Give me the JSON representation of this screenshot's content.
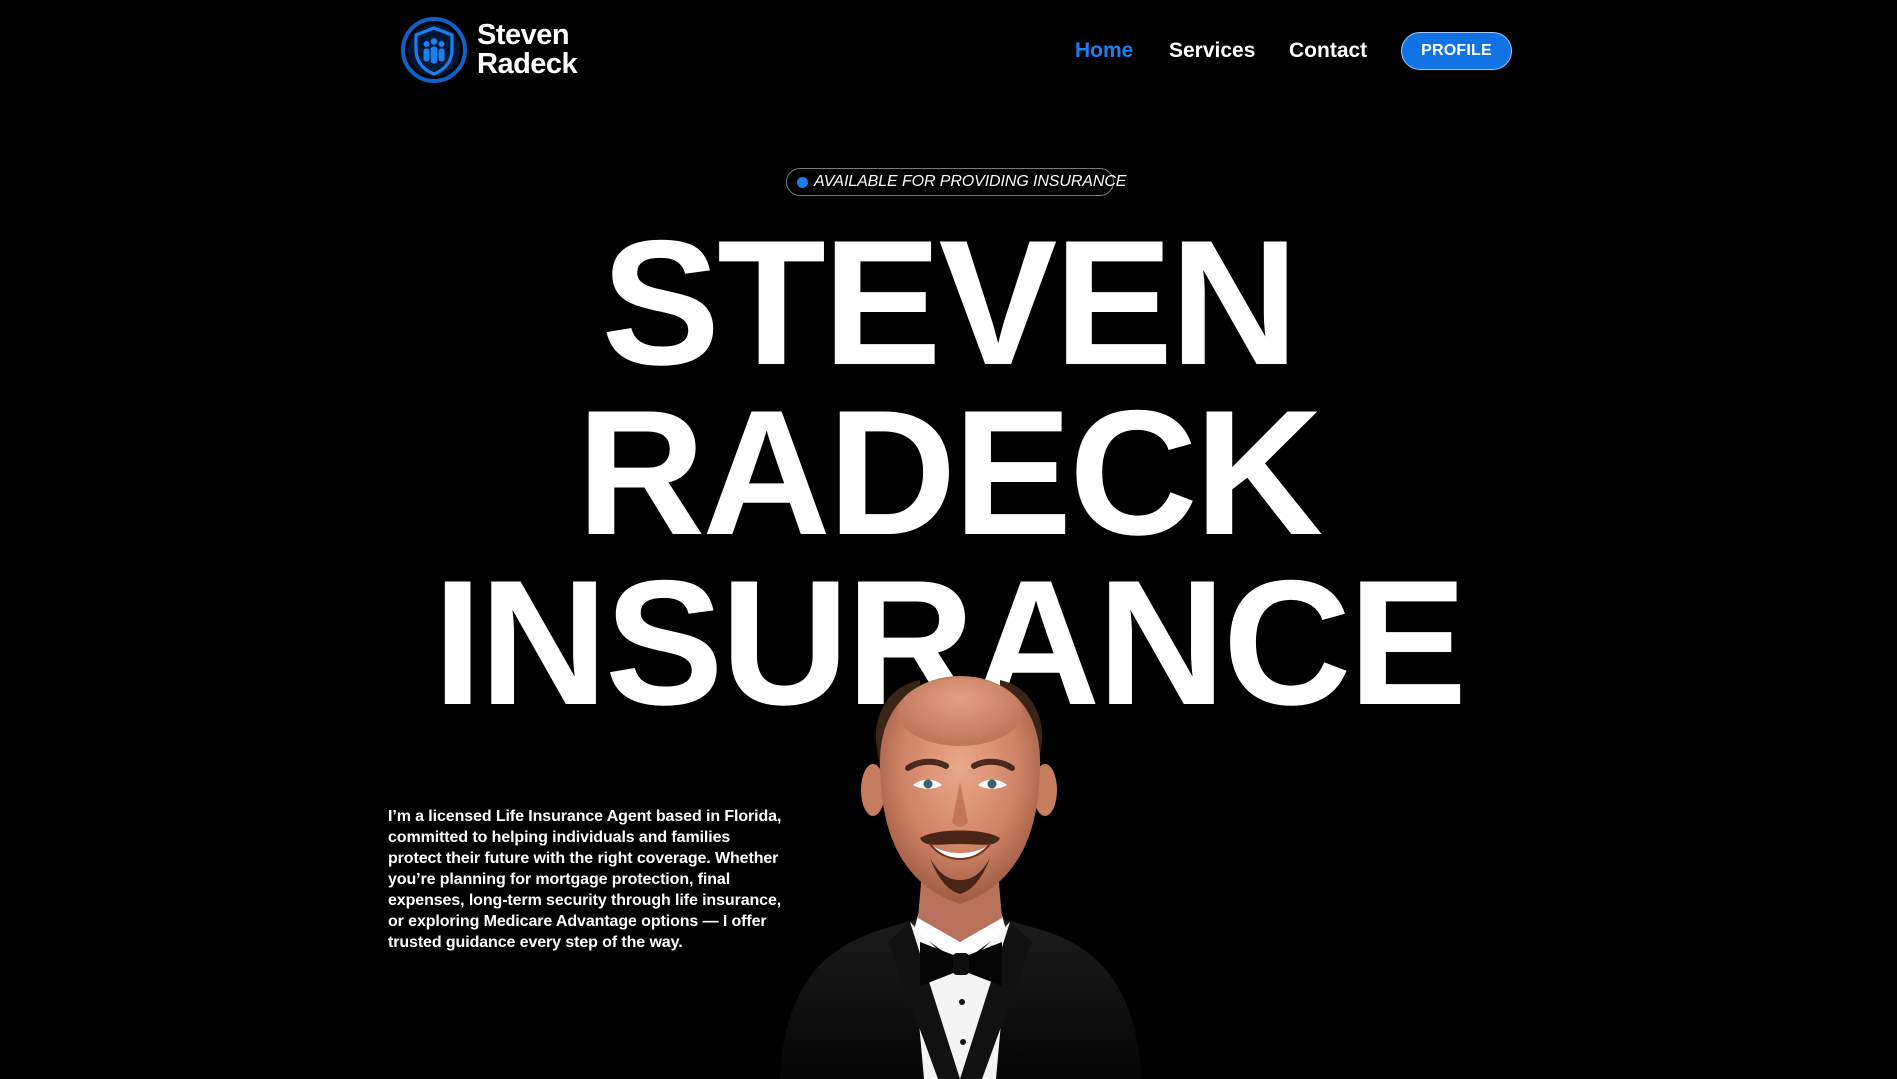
{
  "brand": {
    "line1": "Steven",
    "line2": "Radeck",
    "accent": "#1173e3"
  },
  "nav": {
    "items": [
      {
        "label": "Home",
        "active": true
      },
      {
        "label": "Services",
        "active": false
      },
      {
        "label": "Contact",
        "active": false
      }
    ],
    "profile_label": "PROFILE"
  },
  "hero": {
    "badge": "AVAILABLE FOR PROVIDING INSURANCE",
    "title_lines": [
      "STEVEN",
      "RADECK",
      "INSURANCE"
    ],
    "bio": "I’m a licensed Life Insurance Agent based in Florida, committed to helping individuals and families protect their future with the right coverage. Whether you’re planning for mortgage protection, final expenses, long-term security through life insurance, or exploring Medicare Advantage options — I offer trusted guidance every step of the way."
  },
  "icons": {
    "logo": "shield-family-icon",
    "badge_dot": "status-dot-icon"
  }
}
